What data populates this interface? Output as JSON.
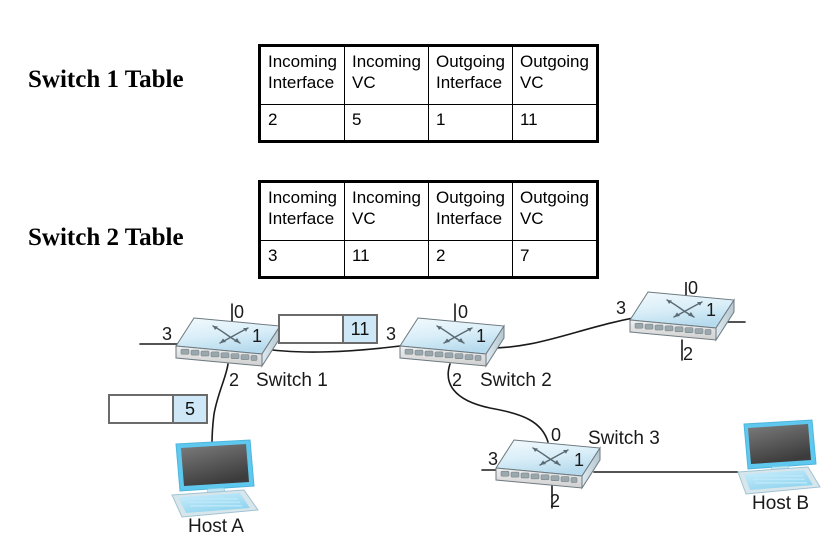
{
  "tables": [
    {
      "label": "Switch 1 Table",
      "headers": [
        "Incoming\nInterface",
        "Incoming\nVC",
        "Outgoing\nInterface",
        "Outgoing\nVC"
      ],
      "header_lines": [
        [
          "Incoming",
          "Interface"
        ],
        [
          "Incoming",
          "VC"
        ],
        [
          "Outgoing",
          "Interface"
        ],
        [
          "Outgoing",
          "VC"
        ]
      ],
      "row": [
        "2",
        "5",
        "1",
        "11"
      ]
    },
    {
      "label": "Switch 2 Table",
      "headers": [
        "Incoming\nInterface",
        "Incoming\nVC",
        "Outgoing\nInterface",
        "Outgoing\nVC"
      ],
      "header_lines": [
        [
          "Incoming",
          "Interface"
        ],
        [
          "Incoming",
          "VC"
        ],
        [
          "Outgoing",
          "Interface"
        ],
        [
          "Outgoing",
          "VC"
        ]
      ],
      "row": [
        "3",
        "11",
        "2",
        "7"
      ]
    }
  ],
  "diagram": {
    "switches": [
      {
        "name": "Switch 1",
        "ports": {
          "top": "0",
          "left": "3",
          "right": "1",
          "bottom": "2"
        }
      },
      {
        "name": "Switch 2",
        "ports": {
          "top": "0",
          "left": "3",
          "right": "1",
          "bottom": "2"
        }
      },
      {
        "name": "",
        "ports": {
          "top": "0",
          "left": "3",
          "right": "1",
          "bottom": "2"
        }
      },
      {
        "name": "Switch 3",
        "ports": {
          "top": "0",
          "left": "3",
          "right": "1",
          "bottom": "2"
        }
      }
    ],
    "hosts": [
      {
        "name": "Host A"
      },
      {
        "name": "Host B"
      }
    ],
    "packets": [
      {
        "vc": "11"
      },
      {
        "vc": "5"
      }
    ]
  },
  "colors": {
    "packet_vc_fill": "#cfe8f7",
    "packet_border": "#6b6b6b",
    "switch_top_light": "#eaf6fc",
    "switch_top_dark": "#b9dcef",
    "link": "#1a1a1a",
    "host_accent": "#5ec8ef"
  }
}
